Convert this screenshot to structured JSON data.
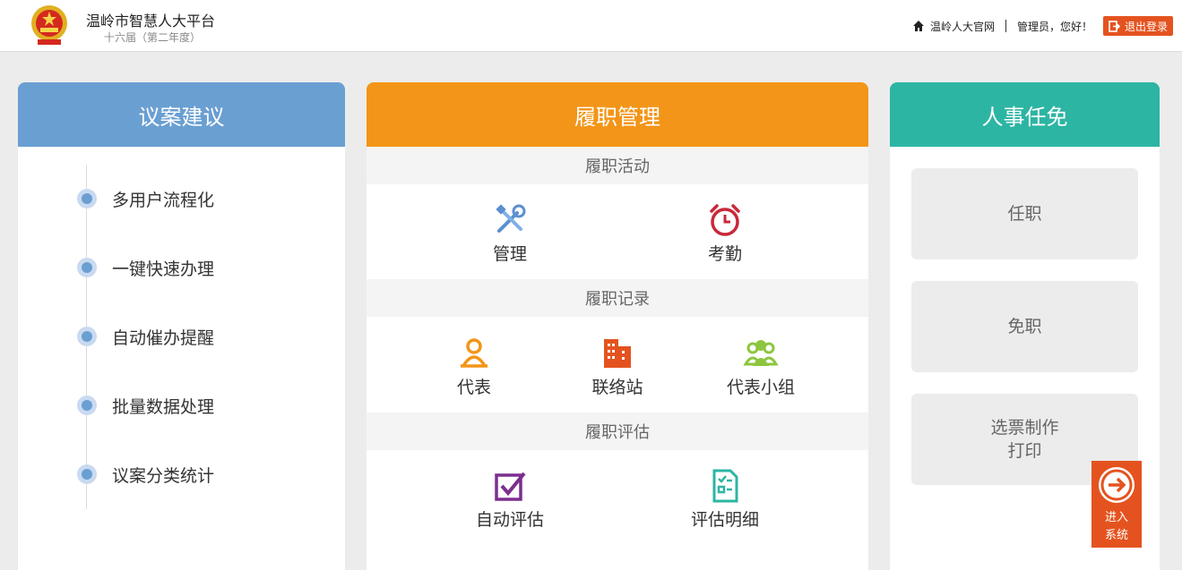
{
  "header": {
    "title": "温岭市智慧人大平台",
    "subtitle": "十六届（第二年度）",
    "official_site": "温岭人大官网",
    "greeting": "管理员，您好！",
    "logout": "退出登录"
  },
  "proposal_panel": {
    "title": "议案建议",
    "items": [
      "多用户流程化",
      "一键快速办理",
      "自动催办提醒",
      "批量数据处理",
      "议案分类统计"
    ]
  },
  "duty_panel": {
    "title": "履职管理",
    "sections": [
      {
        "title": "履职活动",
        "tiles": [
          "管理",
          "考勤"
        ]
      },
      {
        "title": "履职记录",
        "tiles": [
          "代表",
          "联络站",
          "代表小组"
        ]
      },
      {
        "title": "履职评估",
        "tiles": [
          "自动评估",
          "评估明细"
        ]
      }
    ]
  },
  "personnel_panel": {
    "title": "人事任免",
    "buttons": [
      "任职",
      "免职"
    ],
    "ballot_line1": "选票制作",
    "ballot_line2": "打印"
  },
  "enter_button": {
    "line1": "进入",
    "line2": "系统"
  },
  "colors": {
    "blue": "#6a9fd2",
    "orange": "#f39518",
    "teal": "#2db5a3",
    "red": "#e4531f"
  }
}
